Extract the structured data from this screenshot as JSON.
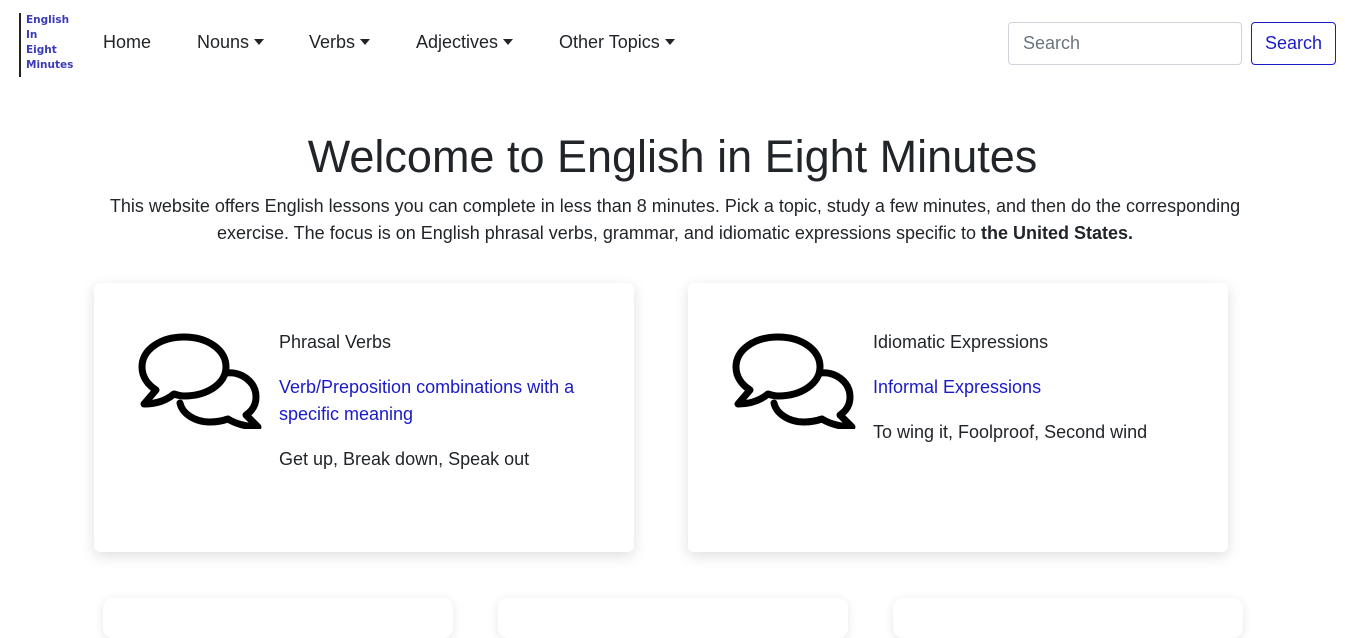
{
  "logo": {
    "lines": [
      "English",
      "In",
      "Eight",
      "Minutes"
    ]
  },
  "nav": {
    "home": "Home",
    "nouns": "Nouns",
    "verbs": "Verbs",
    "adjectives": "Adjectives",
    "other_topics": "Other Topics"
  },
  "search": {
    "placeholder": "Search",
    "button": "Search"
  },
  "hero": {
    "title": "Welcome to English in Eight Minutes",
    "text": "This website offers English lessons you can complete in less than 8 minutes. Pick a topic, study a few minutes, and then do the corresponding exercise. The focus is on English phrasal verbs, grammar, and idiomatic expressions specific to",
    "text_bold": "the United States."
  },
  "cards": [
    {
      "title": "Phrasal Verbs",
      "link": "Verb/Preposition combinations with a specific meaning",
      "examples": "Get up, Break down, Speak out",
      "icon": "speech-bubbles-icon"
    },
    {
      "title": "Idiomatic Expressions",
      "link": "Informal Expressions",
      "examples": "To wing it, Foolproof, Second wind",
      "icon": "speech-bubbles-icon"
    }
  ],
  "colors": {
    "link": "#1a1ac8",
    "logo": "#3b3bb8",
    "text": "#212529"
  }
}
